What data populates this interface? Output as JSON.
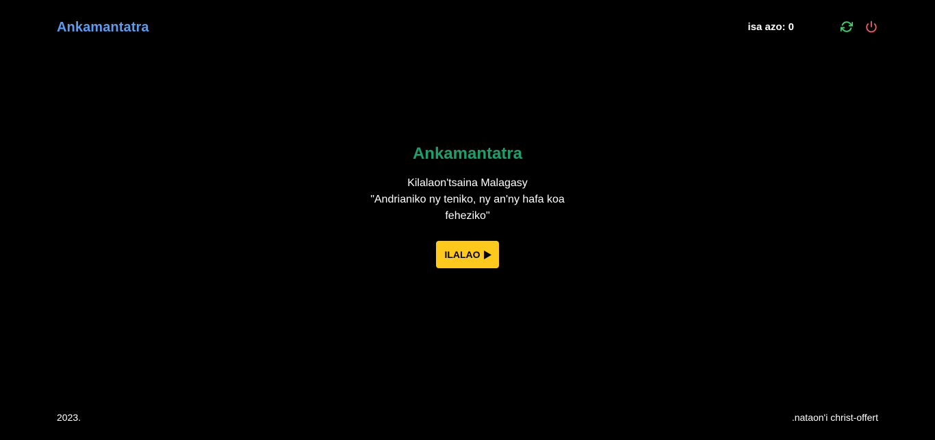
{
  "header": {
    "brand": "Ankamantatra",
    "score_label": "isa azo: 0",
    "refresh_icon": "refresh-icon",
    "power_icon": "power-icon"
  },
  "hero": {
    "title": "Ankamantatra",
    "subtitle": "Kilalaon'tsaina Malagasy",
    "quote": "\"Andrianiko ny teniko, ny an'ny hafa koa feheziko\"",
    "play_label": "ILALAO",
    "play_icon": "play-icon"
  },
  "footer": {
    "year": "2023.",
    "credit": ".nataon'i christ-offert"
  },
  "colors": {
    "background": "#000000",
    "brand": "#5b9cf0",
    "title": "#1aa06c",
    "button": "#fcc91c",
    "refresh": "#3fcf6e",
    "power": "#f0606a"
  }
}
